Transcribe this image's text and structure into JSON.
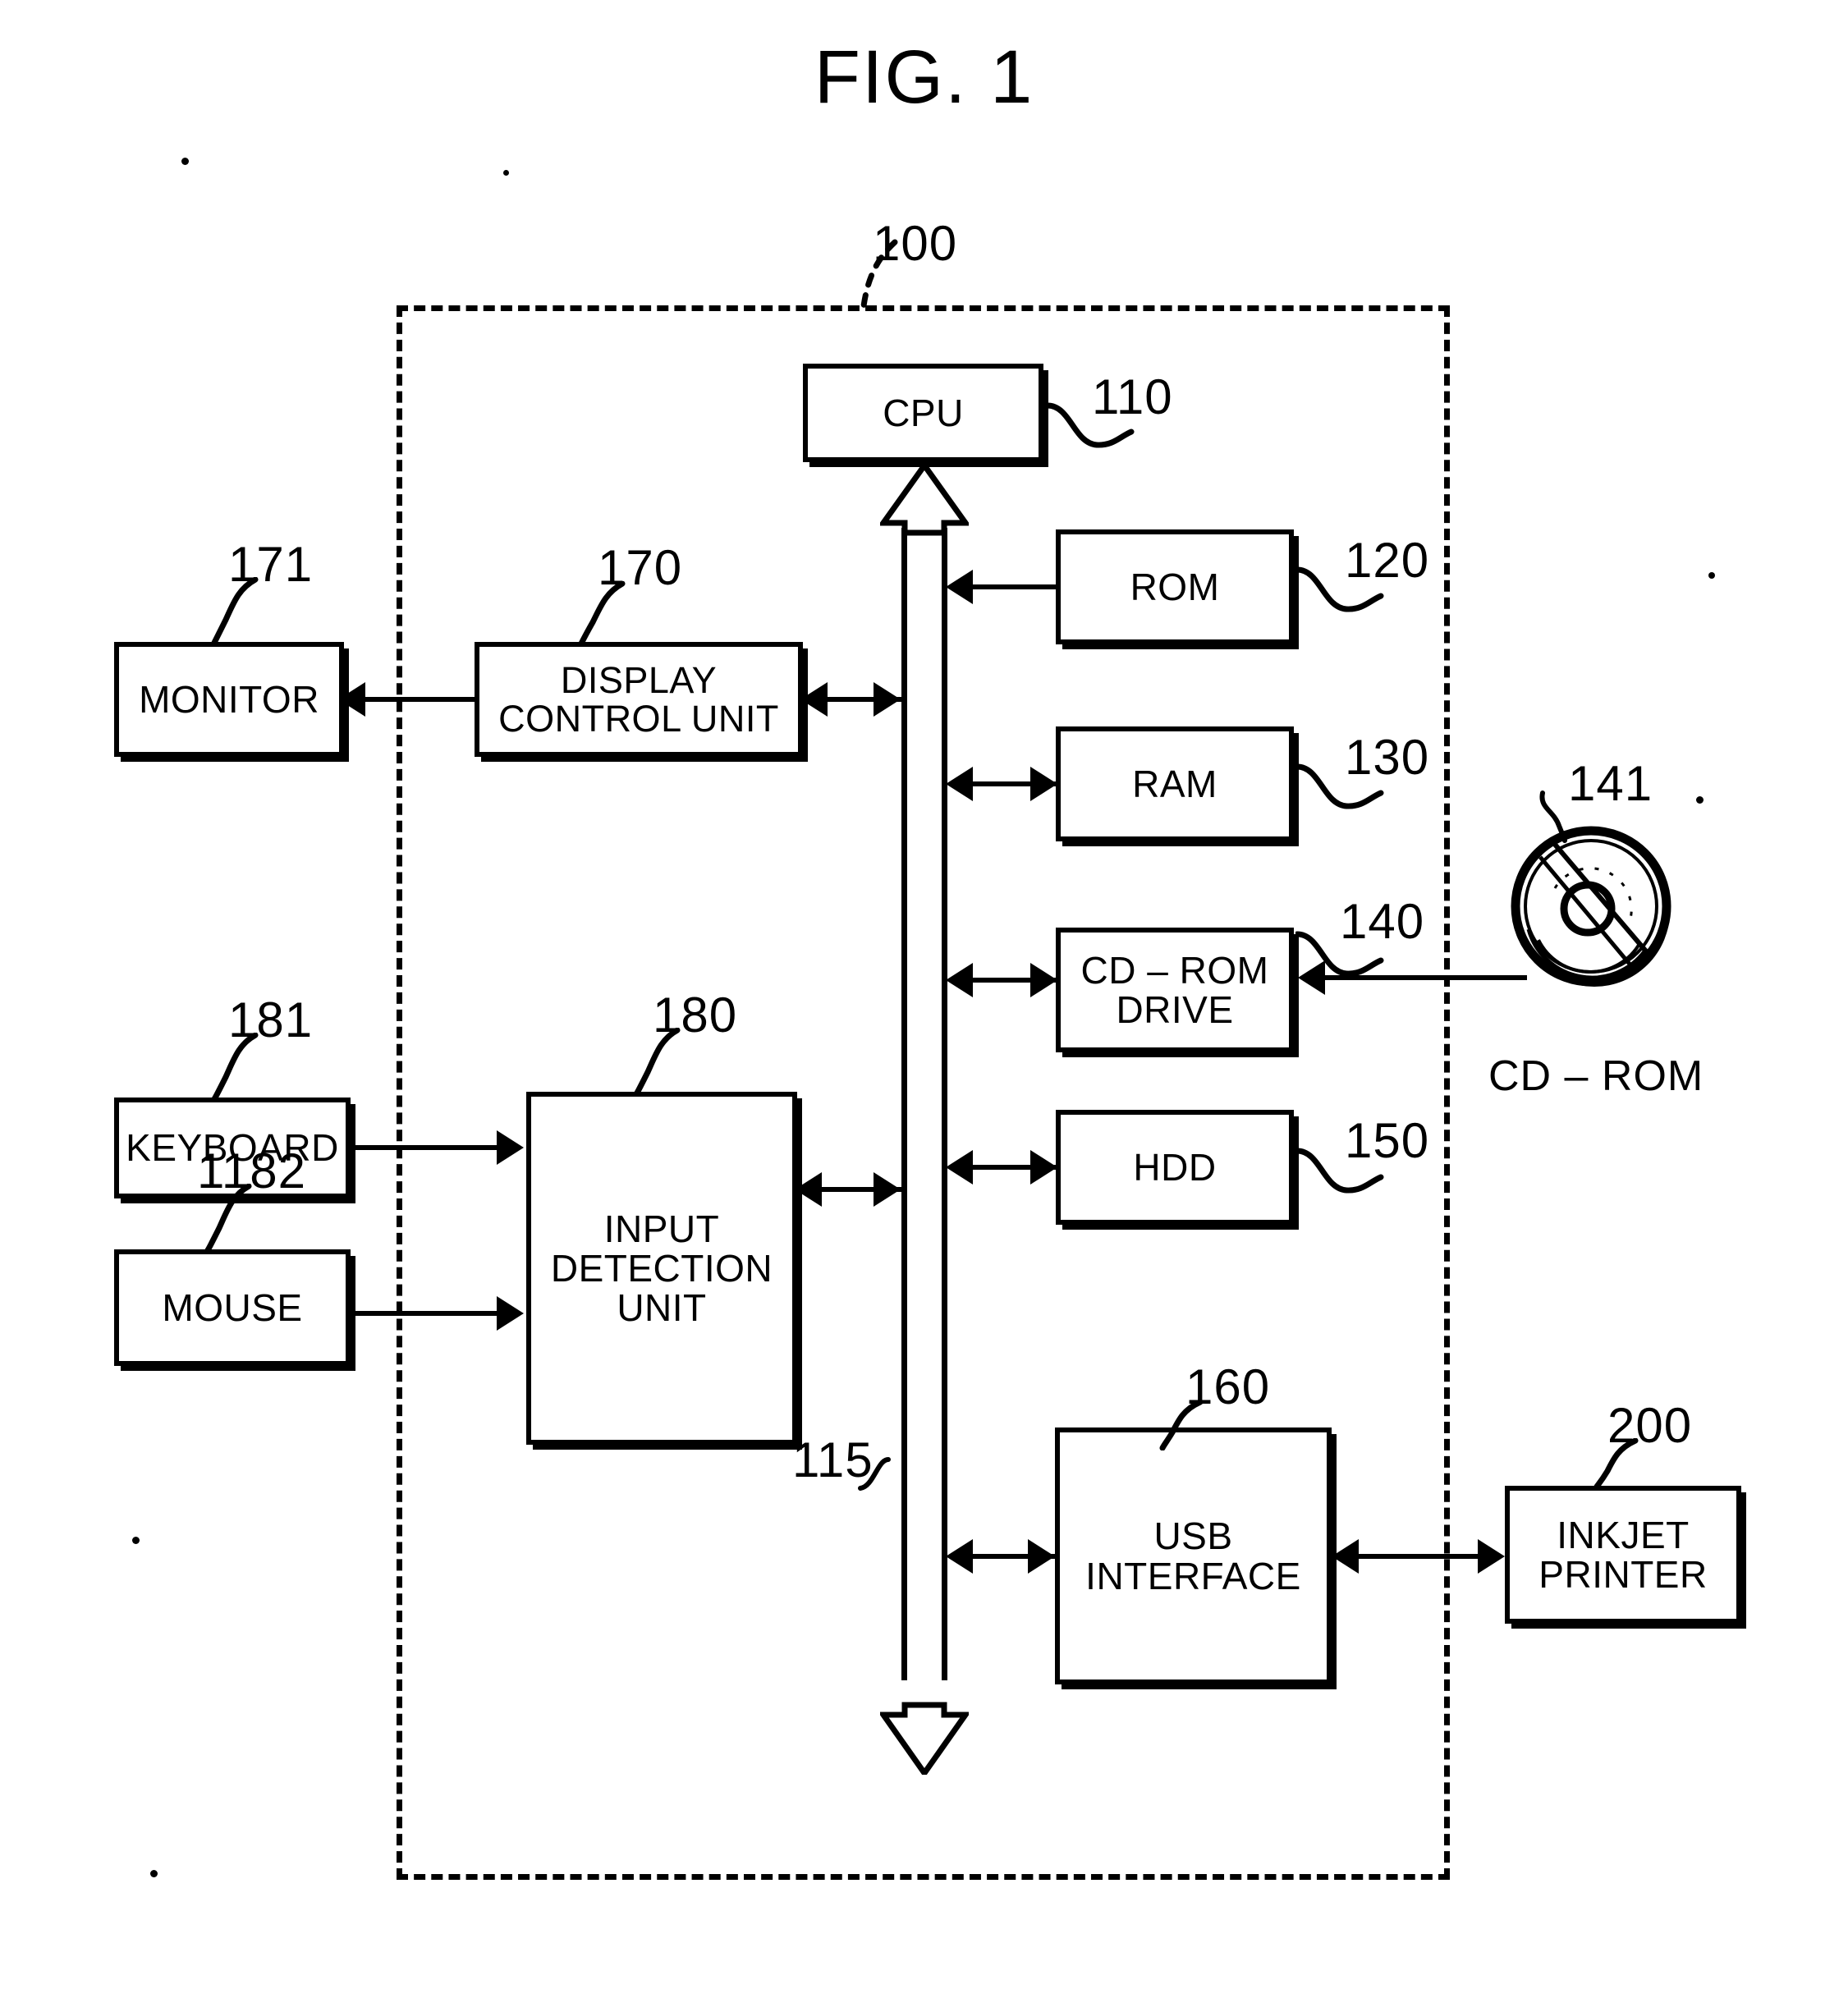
{
  "figure": {
    "title": "FIG. 1",
    "type": "patent-block-diagram",
    "subject": "Computer system connected to an inkjet printer"
  },
  "boundary": {
    "label": "100",
    "description": "dashed enclosure representing the host computer"
  },
  "blocks": [
    {
      "id": "cpu",
      "label": "CPU",
      "ref": "110",
      "inside": true
    },
    {
      "id": "rom",
      "label": "ROM",
      "ref": "120",
      "inside": true
    },
    {
      "id": "ram",
      "label": "RAM",
      "ref": "130",
      "inside": true
    },
    {
      "id": "cdrom",
      "label": "CD – ROM\nDRIVE",
      "ref": "140",
      "inside": true
    },
    {
      "id": "hdd",
      "label": "HDD",
      "ref": "150",
      "inside": true
    },
    {
      "id": "usb",
      "label": "USB\nINTERFACE",
      "ref": "160",
      "inside": true
    },
    {
      "id": "display",
      "label": "DISPLAY\nCONTROL UNIT",
      "ref": "170",
      "inside": true
    },
    {
      "id": "monitor",
      "label": "MONITOR",
      "ref": "171",
      "inside": false
    },
    {
      "id": "input",
      "label": "INPUT\nDETECTION\nUNIT",
      "ref": "180",
      "inside": true
    },
    {
      "id": "keyboard",
      "label": "KEYBOARD",
      "ref": "181",
      "inside": false
    },
    {
      "id": "mouse",
      "label": "MOUSE",
      "ref": "1182",
      "inside": false
    },
    {
      "id": "printer",
      "label": "INKJET\nPRINTER",
      "ref": "200",
      "inside": false
    }
  ],
  "block_labels": {
    "cpu_line1": "CPU",
    "rom_line1": "ROM",
    "ram_line1": "RAM",
    "cdrom_line1": "CD – ROM",
    "cdrom_line2": "DRIVE",
    "hdd_line1": "HDD",
    "usb_line1": "USB",
    "usb_line2": "INTERFACE",
    "display_line1": "DISPLAY",
    "display_line2": "CONTROL UNIT",
    "monitor_line1": "MONITOR",
    "input_line1": "INPUT",
    "input_line2": "DETECTION",
    "input_line3": "UNIT",
    "keyboard_line1": "KEYBOARD",
    "mouse_line1": "MOUSE",
    "printer_line1": "INKJET",
    "printer_line2": "PRINTER"
  },
  "refs": {
    "boundary": "100",
    "cpu": "110",
    "rom": "120",
    "ram": "130",
    "cdrom_drive": "140",
    "cdrom_media": "141",
    "hdd": "150",
    "usb": "160",
    "display_control": "170",
    "monitor": "171",
    "input_detection": "180",
    "keyboard": "181",
    "mouse": "1182",
    "bus": "115",
    "printer": "200"
  },
  "media": {
    "cdrom_caption": "CD – ROM"
  },
  "bus": {
    "ref": "115",
    "style": "hollow-double-headed-vertical-arrow"
  },
  "connections": [
    {
      "from": "bus",
      "to": "cpu",
      "arrow": "up"
    },
    {
      "from": "rom",
      "to": "bus",
      "arrow": "left"
    },
    {
      "from": "ram",
      "to": "bus",
      "arrow": "bidirectional"
    },
    {
      "from": "cdrom",
      "to": "bus",
      "arrow": "bidirectional"
    },
    {
      "from": "hdd",
      "to": "bus",
      "arrow": "bidirectional"
    },
    {
      "from": "usb",
      "to": "bus",
      "arrow": "bidirectional"
    },
    {
      "from": "display",
      "to": "bus",
      "arrow": "bidirectional"
    },
    {
      "from": "display",
      "to": "monitor",
      "arrow": "left"
    },
    {
      "from": "keyboard",
      "to": "input",
      "arrow": "right"
    },
    {
      "from": "mouse",
      "to": "input",
      "arrow": "right"
    },
    {
      "from": "input",
      "to": "bus",
      "arrow": "bidirectional"
    },
    {
      "from": "media",
      "to": "cdrom",
      "arrow": "left"
    },
    {
      "from": "usb",
      "to": "printer",
      "arrow": "bidirectional"
    }
  ],
  "colors": {
    "ink": "#000000",
    "paper": "#ffffff"
  }
}
